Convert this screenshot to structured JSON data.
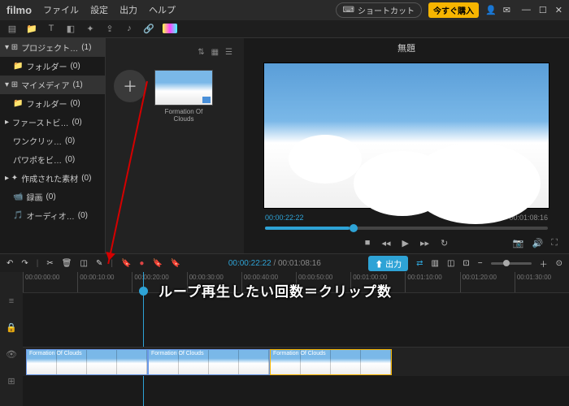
{
  "app": {
    "name": "filmo"
  },
  "menu": {
    "file": "ファイル",
    "settings": "設定",
    "output": "出力",
    "help": "ヘルプ"
  },
  "titlebar": {
    "shortcut_label": "ショートカット",
    "buy_label": "今すぐ購入"
  },
  "sidebar": {
    "project": {
      "label": "プロジェクト…",
      "count": "(1)"
    },
    "folder1": {
      "label": "フォルダー",
      "count": "(0)"
    },
    "mymedia": {
      "label": "マイメディア",
      "count": "(1)"
    },
    "folder2": {
      "label": "フォルダー",
      "count": "(0)"
    },
    "firstview": {
      "label": "ファーストビ…",
      "count": "(0)"
    },
    "oneclick": {
      "label": "ワンクリッ…",
      "count": "(0)"
    },
    "powerpoint": {
      "label": "パワポをビ…",
      "count": "(0)"
    },
    "created": {
      "label": "作成された素材",
      "count": "(0)"
    },
    "rec": {
      "label": "録画",
      "count": "(0)"
    },
    "audio": {
      "label": "オーディオ…",
      "count": "(0)"
    }
  },
  "mediabin": {
    "clip_name": "Formation Of Clouds"
  },
  "preview": {
    "title": "無題",
    "current_time": "00:00:22:22",
    "total_time": "00:01:08:16"
  },
  "timeline_toolbar": {
    "current": "00:00:22:22",
    "duration": "00:01:08:16",
    "export_label": "出力"
  },
  "ruler": {
    "marks": [
      "00:00:00:00",
      "00:00:10:00",
      "00:00:20:00",
      "00:00:30:00",
      "00:00:40:00",
      "00:00:50:00",
      "00:01:00:00",
      "00:01:10:00",
      "00:01:20:00",
      "00:01:30:00"
    ]
  },
  "clips": {
    "c1": "Formation Of Clouds",
    "c2": "Formation Of Clouds",
    "c3": "Formation Of Clouds"
  },
  "annotation": {
    "text": "ループ再生したい回数＝クリップ数"
  }
}
